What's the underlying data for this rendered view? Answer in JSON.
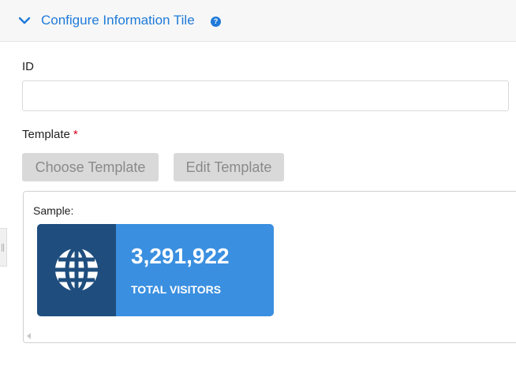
{
  "section": {
    "title": "Configure Information Tile",
    "help_icon": "?"
  },
  "id_field": {
    "label": "ID",
    "value": ""
  },
  "template_field": {
    "label": "Template",
    "required_marker": "*",
    "choose_button": "Choose Template",
    "edit_button": "Edit Template"
  },
  "sample": {
    "label": "Sample:",
    "tile": {
      "value": "3,291,922",
      "caption": "TOTAL VISITORS",
      "icon": "globe-icon",
      "icon_bg_color": "#1f4e7e",
      "bg_color": "#3a8fe0"
    }
  },
  "colors": {
    "accent": "#1f7ad9",
    "required": "#d0021b",
    "button_bg": "#d9d9d9"
  }
}
